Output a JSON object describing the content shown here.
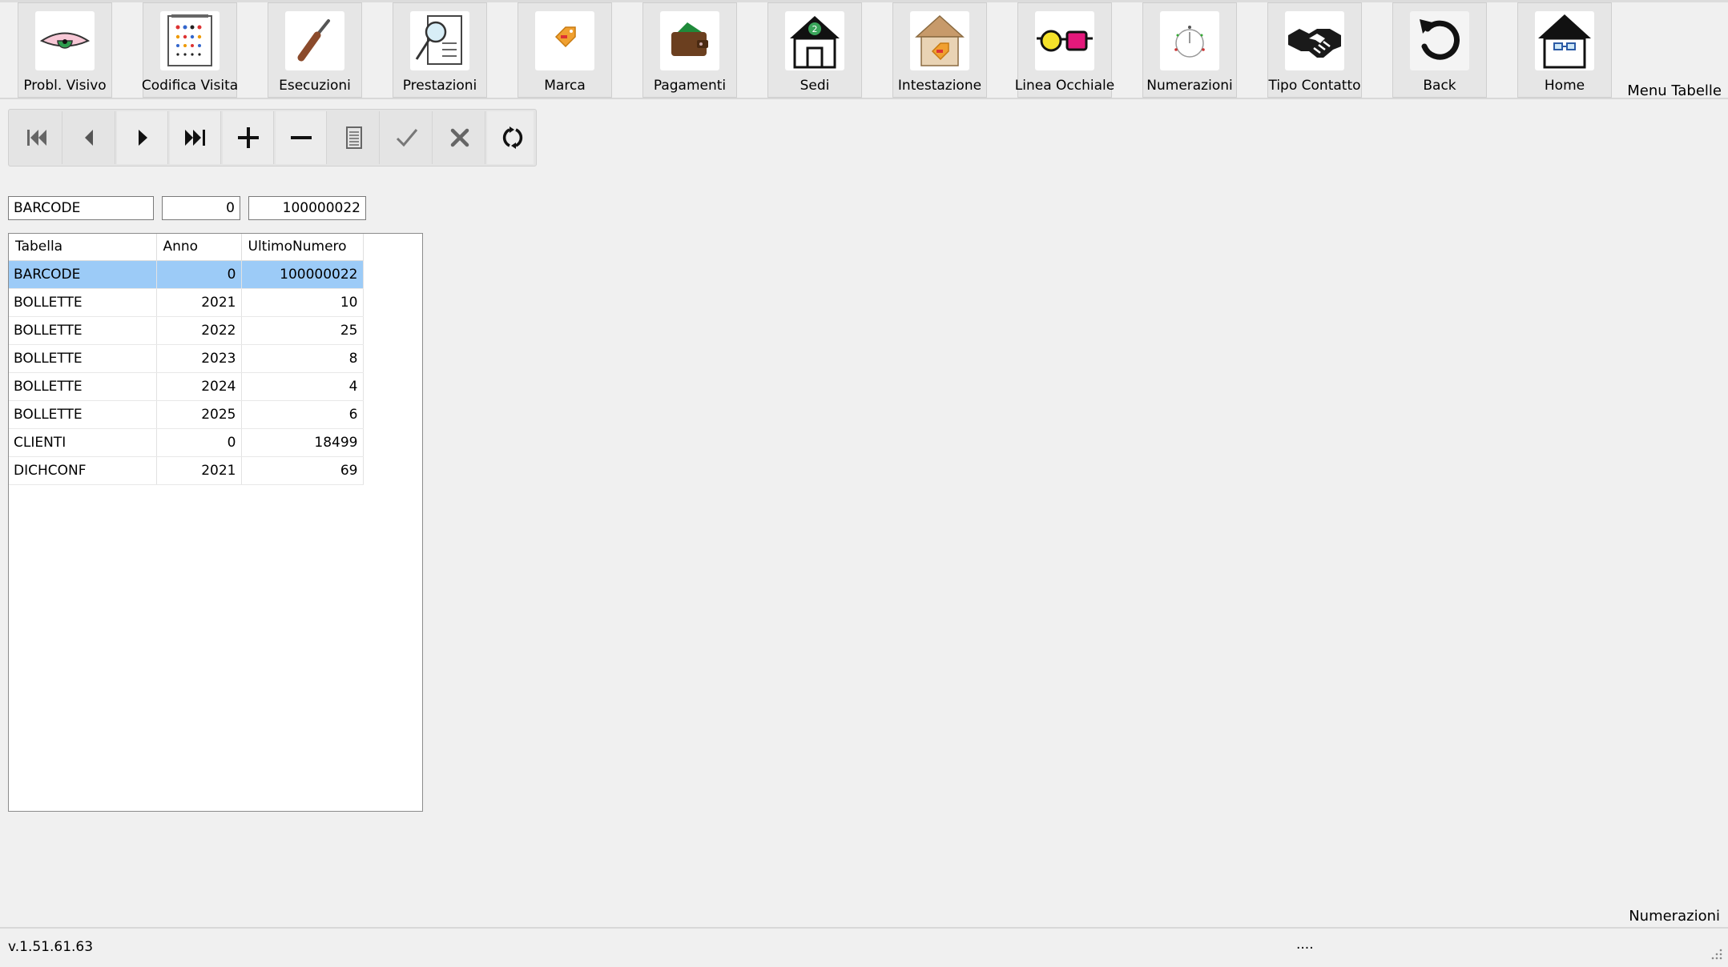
{
  "toolbar": {
    "buttons": [
      {
        "label": "Probl. Visivo",
        "icon": "eye-icon"
      },
      {
        "label": "Codifica Visita",
        "icon": "eye-chart-icon"
      },
      {
        "label": "Esecuzioni",
        "icon": "screwdriver-icon"
      },
      {
        "label": "Prestazioni",
        "icon": "document-magnifier-icon"
      },
      {
        "label": "Marca",
        "icon": "price-tag-icon"
      },
      {
        "label": "Pagamenti",
        "icon": "wallet-icon"
      },
      {
        "label": "Sedi",
        "icon": "house-number-icon"
      },
      {
        "label": "Intestazione",
        "icon": "house-tag-icon"
      },
      {
        "label": "Linea Occhiale",
        "icon": "glasses-icon"
      },
      {
        "label": "Numerazioni",
        "icon": "dial-icon"
      },
      {
        "label": "Tipo Contatto",
        "icon": "handshake-icon"
      },
      {
        "label": "Back",
        "icon": "back-arrow-icon"
      },
      {
        "label": "Home",
        "icon": "home-icon"
      }
    ],
    "menu_title": "Menu Tabelle"
  },
  "navigator": {
    "buttons": [
      "first-record-icon",
      "prior-record-icon",
      "next-record-icon",
      "last-record-icon",
      "insert-icon",
      "delete-icon",
      "edit-icon",
      "post-icon",
      "cancel-icon",
      "refresh-icon"
    ]
  },
  "edit": {
    "tabella": "BARCODE",
    "anno": "0",
    "ultimo_numero": "100000022"
  },
  "grid": {
    "columns": [
      "Tabella",
      "Anno",
      "UltimoNumero"
    ],
    "rows": [
      {
        "tabella": "BARCODE",
        "anno": "0",
        "ultimo_numero": "100000022",
        "selected": true
      },
      {
        "tabella": "BOLLETTE",
        "anno": "2021",
        "ultimo_numero": "10"
      },
      {
        "tabella": "BOLLETTE",
        "anno": "2022",
        "ultimo_numero": "25"
      },
      {
        "tabella": "BOLLETTE",
        "anno": "2023",
        "ultimo_numero": "8"
      },
      {
        "tabella": "BOLLETTE",
        "anno": "2024",
        "ultimo_numero": "4"
      },
      {
        "tabella": "BOLLETTE",
        "anno": "2025",
        "ultimo_numero": "6"
      },
      {
        "tabella": "CLIENTI",
        "anno": "0",
        "ultimo_numero": "18499"
      },
      {
        "tabella": "DICHCONF",
        "anno": "2021",
        "ultimo_numero": "69"
      }
    ],
    "selection_color": "#9ccbf7"
  },
  "footer": {
    "form_title": "Numerazioni",
    "version": "v.1.51.61.63",
    "status_text": "...."
  }
}
